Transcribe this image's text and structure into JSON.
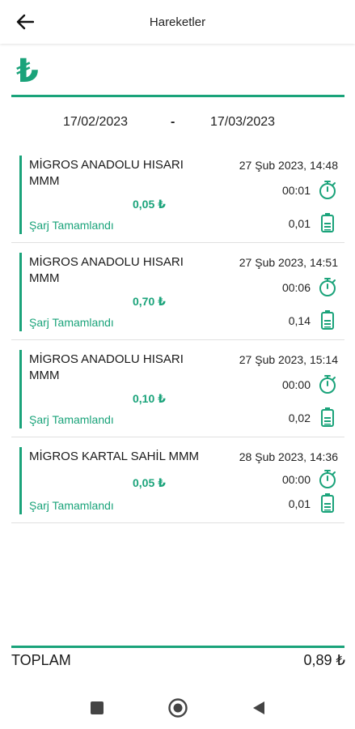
{
  "header": {
    "title": "Hareketler"
  },
  "currency_symbol": "₺",
  "date_range": {
    "from": "17/02/2023",
    "separator": "-",
    "to": "17/03/2023"
  },
  "transactions": [
    {
      "station": "MİGROS ANADOLU HISARI MMM",
      "datetime": "27 Şub 2023, 14:48",
      "duration": "00:01",
      "amount": "0,05 ₺",
      "energy": "0,01",
      "status": "Şarj Tamamlandı"
    },
    {
      "station": "MİGROS ANADOLU HISARI MMM",
      "datetime": "27 Şub 2023, 14:51",
      "duration": "00:06",
      "amount": "0,70 ₺",
      "energy": "0,14",
      "status": "Şarj Tamamlandı"
    },
    {
      "station": "MİGROS ANADOLU HISARI MMM",
      "datetime": "27 Şub 2023, 15:14",
      "duration": "00:00",
      "amount": "0,10 ₺",
      "energy": "0,02",
      "status": "Şarj Tamamlandı"
    },
    {
      "station": "MİGROS KARTAL SAHİL MMM",
      "datetime": "28 Şub 2023, 14:36",
      "duration": "00:00",
      "amount": "0,05 ₺",
      "energy": "0,01",
      "status": "Şarj Tamamlandı"
    }
  ],
  "total": {
    "label": "TOPLAM",
    "value": "0,89 ₺"
  },
  "colors": {
    "accent": "#1aa37a"
  },
  "icons": {
    "back": "arrow-left-icon",
    "timer": "stopwatch-icon",
    "energy": "battery-icon",
    "nav_recents": "square-icon",
    "nav_home": "circle-icon",
    "nav_back": "triangle-back-icon"
  }
}
